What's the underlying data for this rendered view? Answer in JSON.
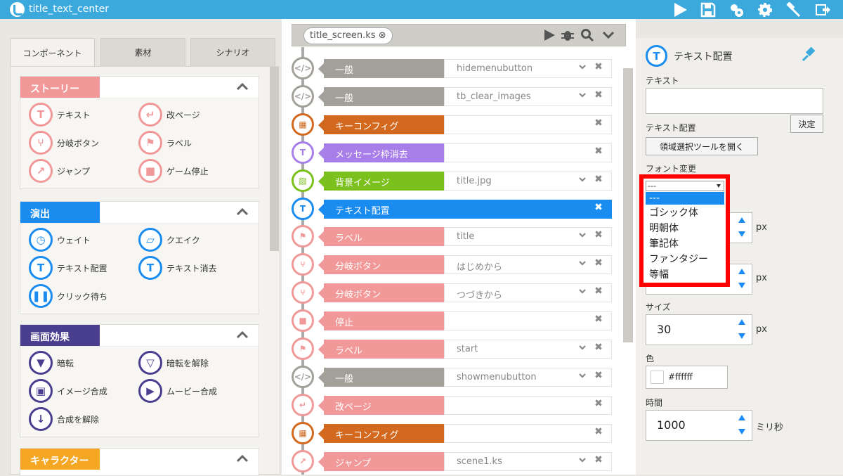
{
  "app": {
    "title": "title_text_center"
  },
  "left": {
    "tabs": [
      "コンポーネント",
      "素材",
      "シナリオ"
    ],
    "categories": [
      {
        "label": "ストーリー",
        "color": "#f19999",
        "items": [
          "テキスト",
          "改ページ",
          "分岐ボタン",
          "ラベル",
          "ジャンプ",
          "ゲーム停止"
        ]
      },
      {
        "label": "演出",
        "color": "#1a8cf0",
        "items": [
          "ウェイト",
          "クエイク",
          "テキスト配置",
          "テキスト消去",
          "クリック待ち"
        ]
      },
      {
        "label": "画面効果",
        "color": "#4a3f8f",
        "items": [
          "暗転",
          "暗転を解除",
          "イメージ合成",
          "ムービー合成",
          "合成を解除"
        ]
      },
      {
        "label": "キャラクター",
        "color": "#f5a623",
        "items": []
      }
    ]
  },
  "file_tab": {
    "name": "title_screen.ks"
  },
  "rows": [
    {
      "label": "一般",
      "value": "hidemenubutton",
      "color": "#a3a09a"
    },
    {
      "label": "一般",
      "value": "tb_clear_images",
      "color": "#a3a09a"
    },
    {
      "label": "キーコンフィグ",
      "value": "",
      "color": "#d2691e"
    },
    {
      "label": "メッセージ枠消去",
      "value": "",
      "color": "#a87ee8"
    },
    {
      "label": "背景イメージ",
      "value": "title.jpg",
      "color": "#7cc01e"
    },
    {
      "label": "テキスト配置",
      "value": "",
      "color": "#1a8cf0"
    },
    {
      "label": "ラベル",
      "value": "title",
      "color": "#f19999"
    },
    {
      "label": "分岐ボタン",
      "value": "はじめから",
      "color": "#f19999"
    },
    {
      "label": "分岐ボタン",
      "value": "つづきから",
      "color": "#f19999"
    },
    {
      "label": "停止",
      "value": "",
      "color": "#f19999"
    },
    {
      "label": "ラベル",
      "value": "start",
      "color": "#f19999"
    },
    {
      "label": "一般",
      "value": "showmenubutton",
      "color": "#a3a09a"
    },
    {
      "label": "改ページ",
      "value": "",
      "color": "#f19999"
    },
    {
      "label": "キーコンフィグ",
      "value": "",
      "color": "#d2691e"
    },
    {
      "label": "ジャンプ",
      "value": "scene1.ks",
      "color": "#f19999"
    }
  ],
  "right": {
    "title": "テキスト配置",
    "text_label": "テキスト",
    "text_value": "",
    "confirm": "決定",
    "placement_label": "テキスト配置",
    "region_btn": "領域選択ツールを開く",
    "font_label": "フォント変更",
    "px1": "px",
    "px2": "px",
    "size_label": "サイズ",
    "size_value": "30",
    "px3": "px",
    "color_label": "色",
    "color_value": "#ffffff",
    "time_label": "時間",
    "time_value": "1000",
    "ms": "ミリ秒"
  },
  "dropdown": {
    "selected": "---",
    "options": [
      "---",
      "ゴシック体",
      "明朝体",
      "筆記体",
      "ファンタジー",
      "等幅"
    ]
  }
}
